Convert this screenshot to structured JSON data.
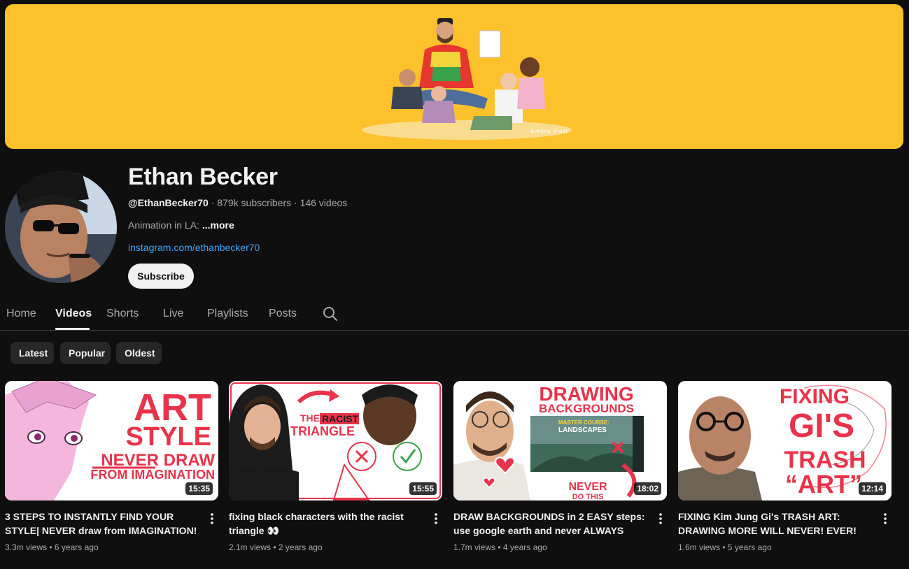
{
  "banner": {
    "watermark": "evelina_maar"
  },
  "channel": {
    "name": "Ethan Becker",
    "handle": "@EthanBecker70",
    "subscribers": "879k subscribers",
    "videos": "146 videos",
    "description": "Animation in LA: ",
    "more_label": "...more",
    "link": "instagram.com/ethanbecker70",
    "subscribe_label": "Subscribe"
  },
  "tabs": [
    {
      "label": "Home",
      "active": false
    },
    {
      "label": "Videos",
      "active": true
    },
    {
      "label": "Shorts",
      "active": false
    },
    {
      "label": "Live",
      "active": false
    },
    {
      "label": "Playlists",
      "active": false
    },
    {
      "label": "Posts",
      "active": false
    }
  ],
  "chips": [
    {
      "label": "Latest"
    },
    {
      "label": "Popular"
    },
    {
      "label": "Oldest"
    }
  ],
  "videos": [
    {
      "title": "3 STEPS TO INSTANTLY FIND YOUR STYLE| NEVER draw from IMAGINATION!",
      "views": "3.3m views",
      "age": "6 years ago",
      "duration": "15:35",
      "thumb_text": [
        "ART",
        "STYLE",
        "NEVER DRAW",
        "FROM IMAGINATION"
      ]
    },
    {
      "title": "fixing black characters with the racist triangle 👀",
      "views": "2.1m views",
      "age": "2 years ago",
      "duration": "15:55",
      "thumb_text": [
        "THE",
        "RACIST",
        "TRIANGLE"
      ]
    },
    {
      "title": "DRAW BACKGROUNDS in 2 EASY steps: use google earth and never ALWAYS listen to...",
      "views": "1.7m views",
      "age": "4 years ago",
      "duration": "18:02",
      "thumb_text": [
        "DRAWING",
        "BACKGROUNDS",
        "MASTER COURSE:",
        "LANDSCAPES",
        "NEVER",
        "DO THIS"
      ]
    },
    {
      "title": "FIXING Kim Jung Gi's TRASH ART: DRAWING MORE WILL NEVER! EVER! MAKE YOU better",
      "views": "1.6m views",
      "age": "5 years ago",
      "duration": "12:14",
      "thumb_text": [
        "FIXING",
        "GI'S",
        "TRASH",
        "“ART”"
      ]
    }
  ],
  "colors": {
    "banner": "#fdc12b",
    "link": "#3ea6ff",
    "accent_red": "#e8334a"
  }
}
